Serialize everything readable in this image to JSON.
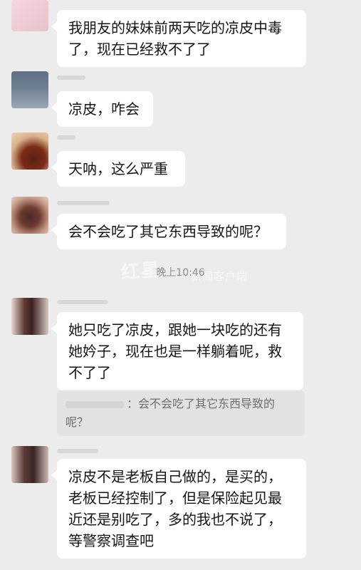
{
  "colors": {
    "background": "#ececec",
    "bubble": "#ffffff",
    "quote": "#e2e2e2",
    "text": "#151515",
    "muted": "#8f8f8f"
  },
  "messages": [
    {
      "text": "我朋友的妹妹前两天吃的凉皮中毒了，现在已经救不了了"
    },
    {
      "text": "凉皮，咋会"
    },
    {
      "text": "天呐，这么严重"
    },
    {
      "text": "会不会吃了其它东西导致的呢？"
    },
    {
      "text": "她只吃了凉皮，跟她一块吃的还有她妗子，现在也是一样躺着呢，救不了了"
    },
    {
      "text": "凉皮不是老板自己做的，是买的，老板已经控制了，但是保险起见最近还是别吃了，多的我也不说了，等警察调查吧"
    }
  ],
  "timestamp": "晚上10:46",
  "quote": {
    "text": "：会不会吃了其它东西导致的呢？"
  }
}
